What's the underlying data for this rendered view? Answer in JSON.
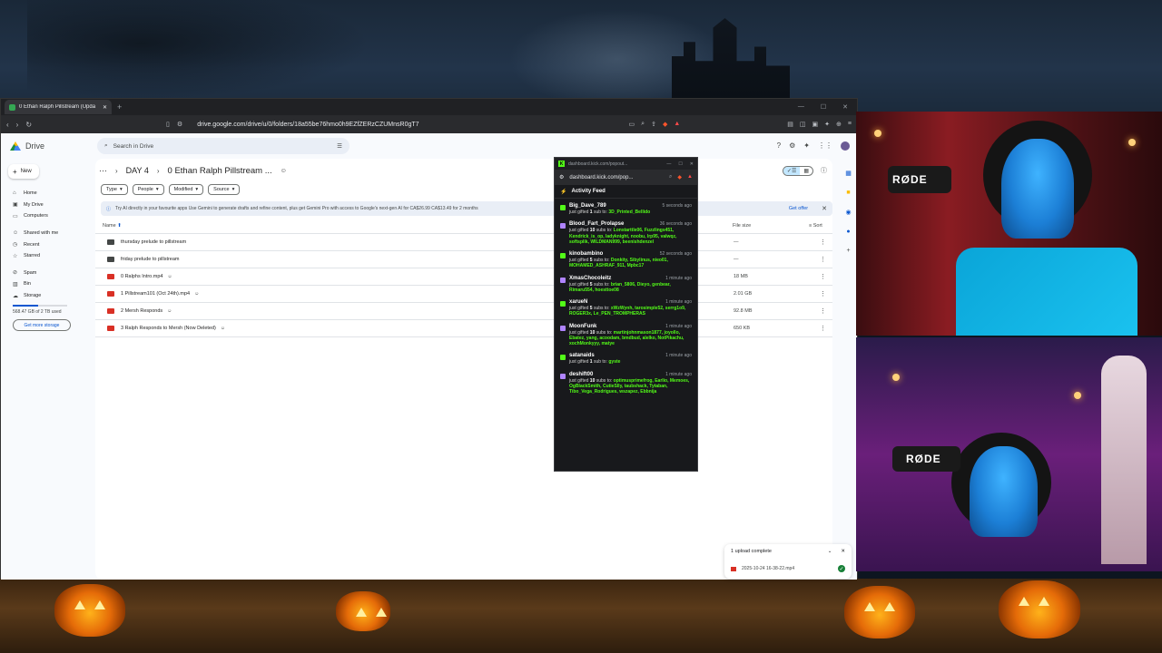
{
  "browser": {
    "tab_title": "0 Ethan Ralph Pillstream (Upda",
    "url": "drive.google.com/drive/u/0/folders/18a55be76hmo0h9EZfZERzCZUMnsR0gT7"
  },
  "drive": {
    "app_name": "Drive",
    "search_placeholder": "Search in Drive",
    "new_label": "New",
    "nav": [
      "Home",
      "My Drive",
      "Computers",
      "Shared with me",
      "Recent",
      "Starred",
      "Spam",
      "Bin",
      "Storage"
    ],
    "storage_text": "568.47 GB of 2 TB used",
    "get_more_storage": "Get more storage",
    "breadcrumb": {
      "parent": "DAY 4",
      "current": "0 Ethan Ralph Pillstream ..."
    },
    "filters": [
      "Type",
      "People",
      "Modified",
      "Source"
    ],
    "banner": {
      "text": "Try AI directly in your favourite apps Use Gemini to generate drafts and refine content, plus get Gemini Pro with access to Google's next-gen AI for CA$26.99 CA$13.49 for 2 months",
      "offer": "Get offer"
    },
    "columns": {
      "name": "Name",
      "size": "File size",
      "sort": "Sort"
    },
    "files": [
      {
        "name": "thursday prelude to pillstream",
        "size": "—"
      },
      {
        "name": "friday prelude to pillstream",
        "size": "—"
      },
      {
        "name": "0 Ralphs Intro.mp4",
        "size": "18 MB"
      },
      {
        "name": "1 Pillstream101 (Oct 24th).mp4",
        "size": "2.01 GB"
      },
      {
        "name": "2 Mersh Responds",
        "size": "92.8 MB"
      },
      {
        "name": "3 Ralph Responds to Mersh (Now Deleted)",
        "size": "650 KB"
      }
    ],
    "upload": {
      "title": "1 upload complete",
      "file": "2025-10-24 16-38-22.mp4"
    }
  },
  "kick": {
    "window_title": "dashboard.kick.com/popout...",
    "address": "dashboard.kick.com/pop...",
    "feed_title": "Activity Feed",
    "events": [
      {
        "user": "Big_Dave_789",
        "time": "5 seconds ago",
        "count": "1",
        "unit": "sub",
        "recipients": "3D_Printed_Bellido",
        "color": "#53fc18"
      },
      {
        "user": "Blood_Fart_Prolapse",
        "time": "36 seconds ago",
        "count": "10",
        "unit": "subs",
        "recipients": "Lonstarttle06, Fuzzlings451, Kendrick_is_op, ladyknight, noobu, lrp95, valwqz, softsplik, WILDMAN999, beenishdenzel",
        "color": "#b084ff"
      },
      {
        "user": "kinobambino",
        "time": "52 seconds ago",
        "count": "5",
        "unit": "subs",
        "recipients": "Donkity, Sibylinus, nieo01, MOHAMED_ASHRAF_911, Mpbc17",
        "color": "#53fc18"
      },
      {
        "user": "XmasChocoleitz",
        "time": "1 minute ago",
        "count": "5",
        "unit": "subs",
        "recipients": "brian_5806, Dieyo, genbear, Rimaru554, hoesttoe08",
        "color": "#b084ff"
      },
      {
        "user": "xaruеN",
        "time": "1 minute ago",
        "count": "5",
        "unit": "subs",
        "recipients": "xWzWynh, tarosimple52, serrg1o9, ROGER3x, Le_PEN_TROMPHERAS",
        "color": "#53fc18"
      },
      {
        "user": "MoonFunk",
        "time": "1 minute ago",
        "count": "10",
        "unit": "subs",
        "recipients": "martinjohnmason1877, joyollo, Ebatez, yang, acoodam, bmdbud, alelko, NotPikachu, xochMonkyyy, matye",
        "color": "#b084ff"
      },
      {
        "user": "satanaids",
        "time": "1 minute ago",
        "count": "1",
        "unit": "sub",
        "recipients": "gyste",
        "color": "#53fc18"
      },
      {
        "user": "deshift00",
        "time": "1 minute ago",
        "count": "10",
        "unit": "subs",
        "recipients": "optimusprimefrog, Earlio, Memoes, OgBlackSmith, CutieSlly, taubshack, Tytaban, Tibo_Vega_Rodrigues, wszapez, Ebbnija",
        "color": "#b084ff"
      }
    ]
  },
  "cams": {
    "brand_top": "RØDE",
    "brand_bottom": "RØDE"
  }
}
